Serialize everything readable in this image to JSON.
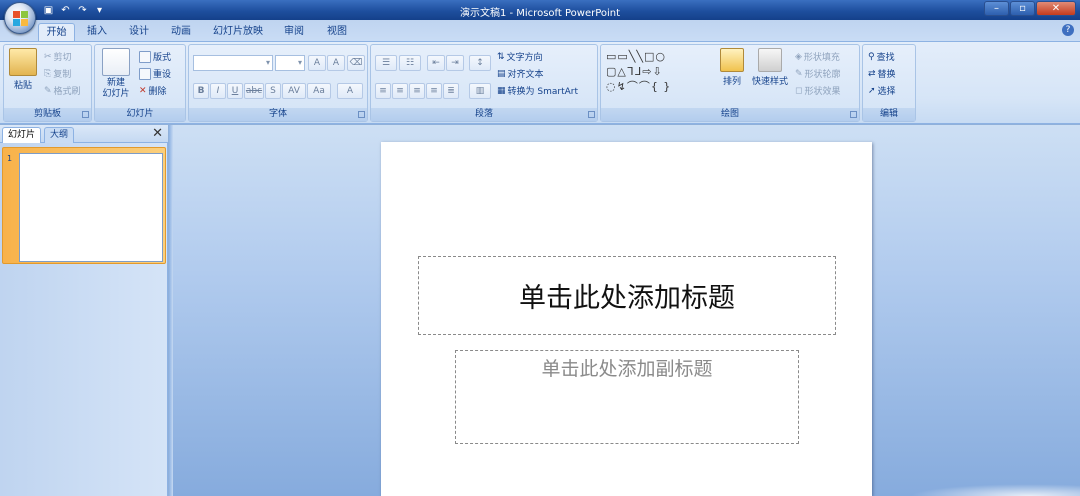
{
  "app": {
    "title": "演示文稿1 - Microsoft PowerPoint",
    "help_glyph": "?"
  },
  "window_controls": {
    "minimize": "–",
    "restore": "▫",
    "close": "✕"
  },
  "qat": [
    "save-icon",
    "undo-icon",
    "redo-icon",
    "customize-icon"
  ],
  "tabs": [
    "开始",
    "插入",
    "设计",
    "动画",
    "幻灯片放映",
    "审阅",
    "视图"
  ],
  "active_tab": "开始",
  "ribbon": {
    "clipboard": {
      "label": "剪贴板",
      "paste": "粘贴",
      "cut": "剪切",
      "copy": "复制",
      "format_painter": "格式刷"
    },
    "slides": {
      "label": "幻灯片",
      "new_slide": "新建\n幻灯片",
      "layout": "版式",
      "reset": "重设",
      "delete": "删除"
    },
    "font": {
      "label": "字体",
      "bold": "B",
      "italic": "I",
      "underline": "U",
      "strike": "abc",
      "shadow": "S",
      "spacing": "AV",
      "case": "Aa",
      "color": "A",
      "grow": "A",
      "shrink": "A"
    },
    "paragraph": {
      "label": "段落",
      "text_direction": "文字方向",
      "align_text": "对齐文本",
      "smartart": "转换为 SmartArt"
    },
    "drawing": {
      "label": "绘图",
      "arrange": "排列",
      "quick_styles": "快速样式",
      "shape_fill": "形状填充",
      "shape_outline": "形状轮廓",
      "shape_effects": "形状效果"
    },
    "editing": {
      "label": "编辑",
      "find": "查找",
      "replace": "替换",
      "select": "选择"
    }
  },
  "pane": {
    "tab_slides": "幻灯片",
    "tab_outline": "大纲",
    "close": "✕",
    "slide_number": "1"
  },
  "slide": {
    "title_placeholder": "单击此处添加标题",
    "subtitle_placeholder": "单击此处添加副标题"
  },
  "colors": {
    "accent": "#15428b",
    "ribbon": "#dbe8f8",
    "titlebar": "#1e4f9e",
    "selection": "#f8b24a"
  }
}
